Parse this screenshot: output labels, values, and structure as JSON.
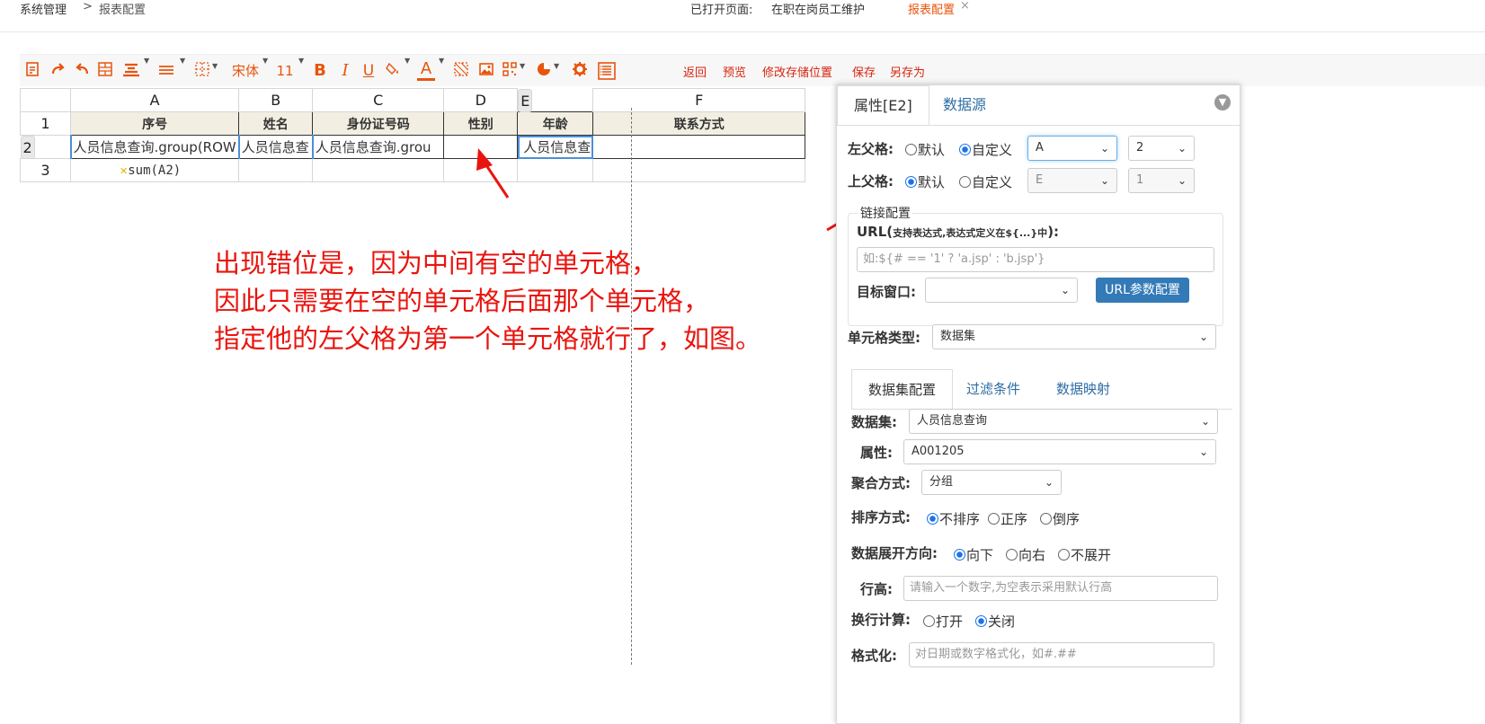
{
  "breadcrumb": {
    "root": "系统管理",
    "sep": ">",
    "current": "报表配置"
  },
  "opened_pages": {
    "label": "已打开页面:",
    "tabs": [
      "在职在岗员工维护",
      "报表配置"
    ],
    "close": "×"
  },
  "toolbar": {
    "font_name": "宋体",
    "font_size": "11",
    "bold": "B",
    "italic": "I",
    "underline": "U",
    "font_color": "A",
    "actions": [
      "返回",
      "预览",
      "修改存储位置",
      "保存",
      "另存为"
    ]
  },
  "sheet": {
    "columns": [
      "A",
      "B",
      "C",
      "D",
      "E",
      "F"
    ],
    "rows": [
      "1",
      "2",
      "3"
    ],
    "header_row": [
      "序号",
      "姓名",
      "身份证号码",
      "性别",
      "年龄",
      "联系方式"
    ],
    "data_row": [
      "人员信息查询.group(ROW",
      "人员信息查",
      "人员信息查询.grou",
      "",
      "人员信息查",
      ""
    ],
    "sum_row": {
      "icon": "✕",
      "formula": "sum(A2)"
    }
  },
  "annotation": {
    "lines": [
      "出现错位是，因为中间有空的单元格，",
      "因此只需要在空的单元格后面那个单元格，",
      "指定他的左父格为第一个单元格就行了，如图。"
    ]
  },
  "panel": {
    "tabs": [
      "属性[E2]",
      "数据源"
    ],
    "left_parent": {
      "label": "左父格:",
      "opt_default": "默认",
      "opt_custom": "自定义",
      "selected": "custom",
      "col": "A",
      "row": "2"
    },
    "top_parent": {
      "label": "上父格:",
      "opt_default": "默认",
      "opt_custom": "自定义",
      "selected": "default",
      "col": "E",
      "row": "1"
    },
    "link": {
      "legend": "链接配置",
      "url_label": "URL(",
      "url_hint": "支持表达式,表达式定义在${...}中",
      "url_close": "):",
      "url_placeholder": "如:${# == '1' ? 'a.jsp' : 'b.jsp'}",
      "target_label": "目标窗口:",
      "target_value": "",
      "param_button": "URL参数配置"
    },
    "cell_type": {
      "label": "单元格类型:",
      "value": "数据集"
    },
    "subtabs": [
      "数据集配置",
      "过滤条件",
      "数据映射"
    ],
    "dataset": {
      "label": "数据集:",
      "value": "人员信息查询"
    },
    "attribute": {
      "label": "属性:",
      "value": "A001205"
    },
    "aggregate": {
      "label": "聚合方式:",
      "value": "分组"
    },
    "sort": {
      "label": "排序方式:",
      "options": [
        "不排序",
        "正序",
        "倒序"
      ],
      "selected": 0
    },
    "expand": {
      "label": "数据展开方向:",
      "options": [
        "向下",
        "向右",
        "不展开"
      ],
      "selected": 0
    },
    "row_height": {
      "label": "行高:",
      "placeholder": "请输入一个数字,为空表示采用默认行高"
    },
    "wrap_calc": {
      "label": "换行计算:",
      "options": [
        "打开",
        "关闭"
      ],
      "selected": 1
    },
    "format": {
      "label": "格式化:",
      "placeholder": "对日期或数字格式化，如#.##"
    }
  },
  "colors": {
    "accent": "#e8540c",
    "link": "#d9230f",
    "annotation": "#e8150e",
    "arrow": "#e8150e",
    "tab_link": "#2e6da4",
    "button": "#337ab7"
  }
}
